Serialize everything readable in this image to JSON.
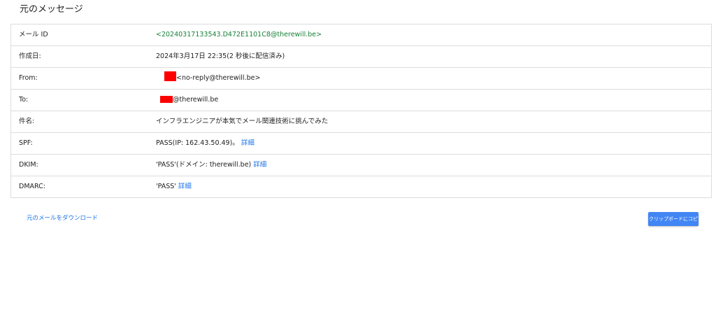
{
  "page": {
    "title": "元のメッセージ"
  },
  "headers": {
    "message_id": {
      "label": "メール ID",
      "value": "<20240317133543.D472E1101C8@therewill.be>"
    },
    "created": {
      "label": "作成日:",
      "value": "2024年3月17日 22:35(2 秒後に配信済み)"
    },
    "from": {
      "label": "From:",
      "value": "<no-reply@therewill.be>"
    },
    "to": {
      "label": "To:",
      "value": "@therewill.be"
    },
    "subject": {
      "label": "件名:",
      "value": "インフラエンジニアが本気でメール関連技術に挑んでみた"
    },
    "spf": {
      "label": "SPF:",
      "value": "PASS(IP: 162.43.50.49)。",
      "link": "詳細"
    },
    "dkim": {
      "label": "DKIM:",
      "value": "'PASS'(ドメイン: therewill.be)",
      "link": "詳細"
    },
    "dmarc": {
      "label": "DMARC:",
      "value": "'PASS'",
      "link": "詳細"
    }
  },
  "actions": {
    "download_label": "元のメールをダウンロード",
    "copy_label": "クリップボードにコピー"
  },
  "colors": {
    "message_id": "#188038",
    "link": "#1a73e8",
    "button": "#4285f4",
    "redaction": "#ff0000",
    "border": "#dadce0"
  }
}
